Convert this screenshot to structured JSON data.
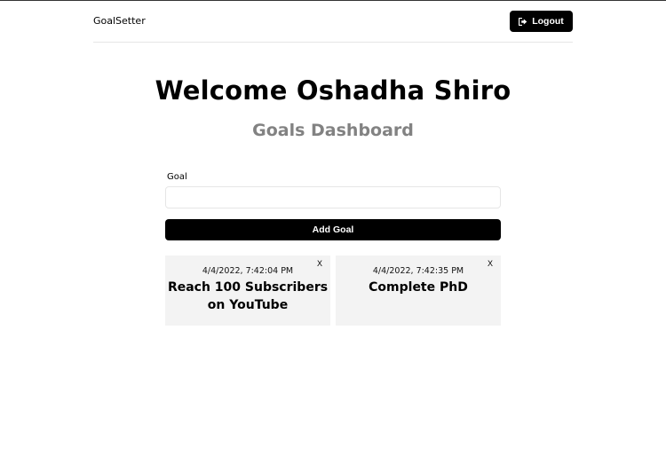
{
  "header": {
    "logo": "GoalSetter",
    "logout_label": "Logout",
    "logout_icon": "sign-out-icon"
  },
  "main": {
    "welcome": "Welcome Oshadha Shiro",
    "subtitle": "Goals Dashboard"
  },
  "form": {
    "goal_label": "Goal",
    "goal_value": "",
    "add_button_label": "Add Goal"
  },
  "goals": [
    {
      "date": "4/4/2022, 7:42:04 PM",
      "text": "Reach 100 Subscribers on YouTube",
      "close_label": "X"
    },
    {
      "date": "4/4/2022, 7:42:35 PM",
      "text": "Complete PhD",
      "close_label": "X"
    }
  ],
  "colors": {
    "accent": "#000000",
    "subtitle": "#828282",
    "card_bg": "#f3f3f3"
  }
}
